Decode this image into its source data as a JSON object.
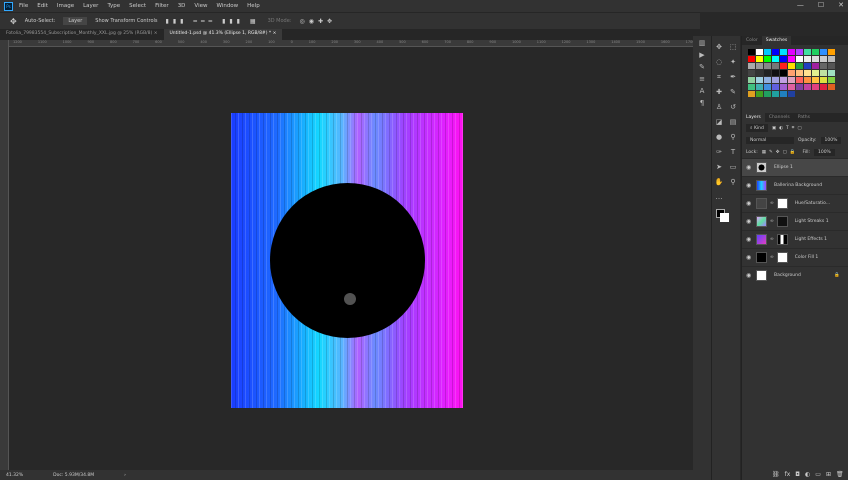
{
  "app": {
    "logo": "Ps"
  },
  "menu": [
    "File",
    "Edit",
    "Image",
    "Layer",
    "Type",
    "Select",
    "Filter",
    "3D",
    "View",
    "Window",
    "Help"
  ],
  "window_controls": [
    "—",
    "☐",
    "✕"
  ],
  "options": {
    "auto_select": "Auto-Select:",
    "layer_select": "Layer",
    "show_transform": "Show Transform Controls",
    "mode_3d": "3D Mode:"
  },
  "tabs": [
    {
      "label": "Fotolia_79983554_Subscription_Monthly_XXL.jpg @ 25% (RGB/8)",
      "close": "×"
    },
    {
      "label": "Untitled-1.psd @ 41.3% (Ellipse 1, RGB/8#) *",
      "close": "×",
      "active": true
    }
  ],
  "ruler": [
    "1200",
    "1100",
    "1000",
    "900",
    "800",
    "700",
    "600",
    "500",
    "400",
    "300",
    "200",
    "100",
    "0",
    "100",
    "200",
    "300",
    "400",
    "500",
    "600",
    "700",
    "800",
    "900",
    "1000",
    "1100",
    "1200",
    "1300",
    "1400",
    "1500",
    "1600",
    "1700"
  ],
  "status": {
    "zoom": "41.32%",
    "doc": "Doc: 5.93M/34.8M",
    "arrow": "›"
  },
  "panel_tabs_top": [
    "Color",
    "Swatches"
  ],
  "swatch_colors": [
    "#000000",
    "#ffffff",
    "#00c8ff",
    "#0000ff",
    "#00e0ff",
    "#e000ff",
    "#b040ff",
    "#40e0a0",
    "#20d060",
    "#3090ff",
    "#ffa000",
    "#ff0000",
    "#ffff00",
    "#00ff00",
    "#00ffff",
    "#0000ff",
    "#ff00ff",
    "#ffffff",
    "#eeeeee",
    "#dddddd",
    "#cccccc",
    "#bbbbbb",
    "#aaaaaa",
    "#999999",
    "#888888",
    "#777777",
    "#ff2020",
    "#ffe000",
    "#20a040",
    "#2040c0",
    "#a020a0",
    "#666666",
    "#555555",
    "#444444",
    "#333333",
    "#222222",
    "#111111",
    "#000000",
    "#ffa070",
    "#ffc080",
    "#ffe090",
    "#e0f090",
    "#c0e0a0",
    "#a0e0c0",
    "#90d0a0",
    "#a0d0e0",
    "#90b0e0",
    "#a0a0e0",
    "#c0a0e0",
    "#e0a0c0",
    "#ff6060",
    "#ff9040",
    "#ffc040",
    "#e0e040",
    "#80d040",
    "#40c080",
    "#40b0b0",
    "#4090e0",
    "#6060e0",
    "#a060d0",
    "#e060a0",
    "#8040a0",
    "#c040a0",
    "#e04080",
    "#e02040",
    "#e06020",
    "#e0a020",
    "#40a020",
    "#20a060",
    "#20a0a0",
    "#2080c0",
    "#2040a0"
  ],
  "layers_panel": {
    "tabs": [
      "Layers",
      "Channels",
      "Paths"
    ],
    "filter": "Kind",
    "blend": "Normal",
    "opacity_label": "Opacity:",
    "opacity": "100%",
    "lock_label": "Lock:",
    "fill_label": "Fill:",
    "fill": "100%",
    "layers": [
      {
        "name": "Ellipse 1",
        "selected": true
      },
      {
        "name": "Ballerina Background"
      },
      {
        "name": "Hue/Saturatio..."
      },
      {
        "name": "Light Streaks 1"
      },
      {
        "name": "Light Effects 1"
      },
      {
        "name": "Color Fill 1"
      },
      {
        "name": "Background",
        "locked": true
      }
    ],
    "footer_icons": [
      "link",
      "fx",
      "mask",
      "adjust",
      "folder",
      "new",
      "trash"
    ]
  }
}
